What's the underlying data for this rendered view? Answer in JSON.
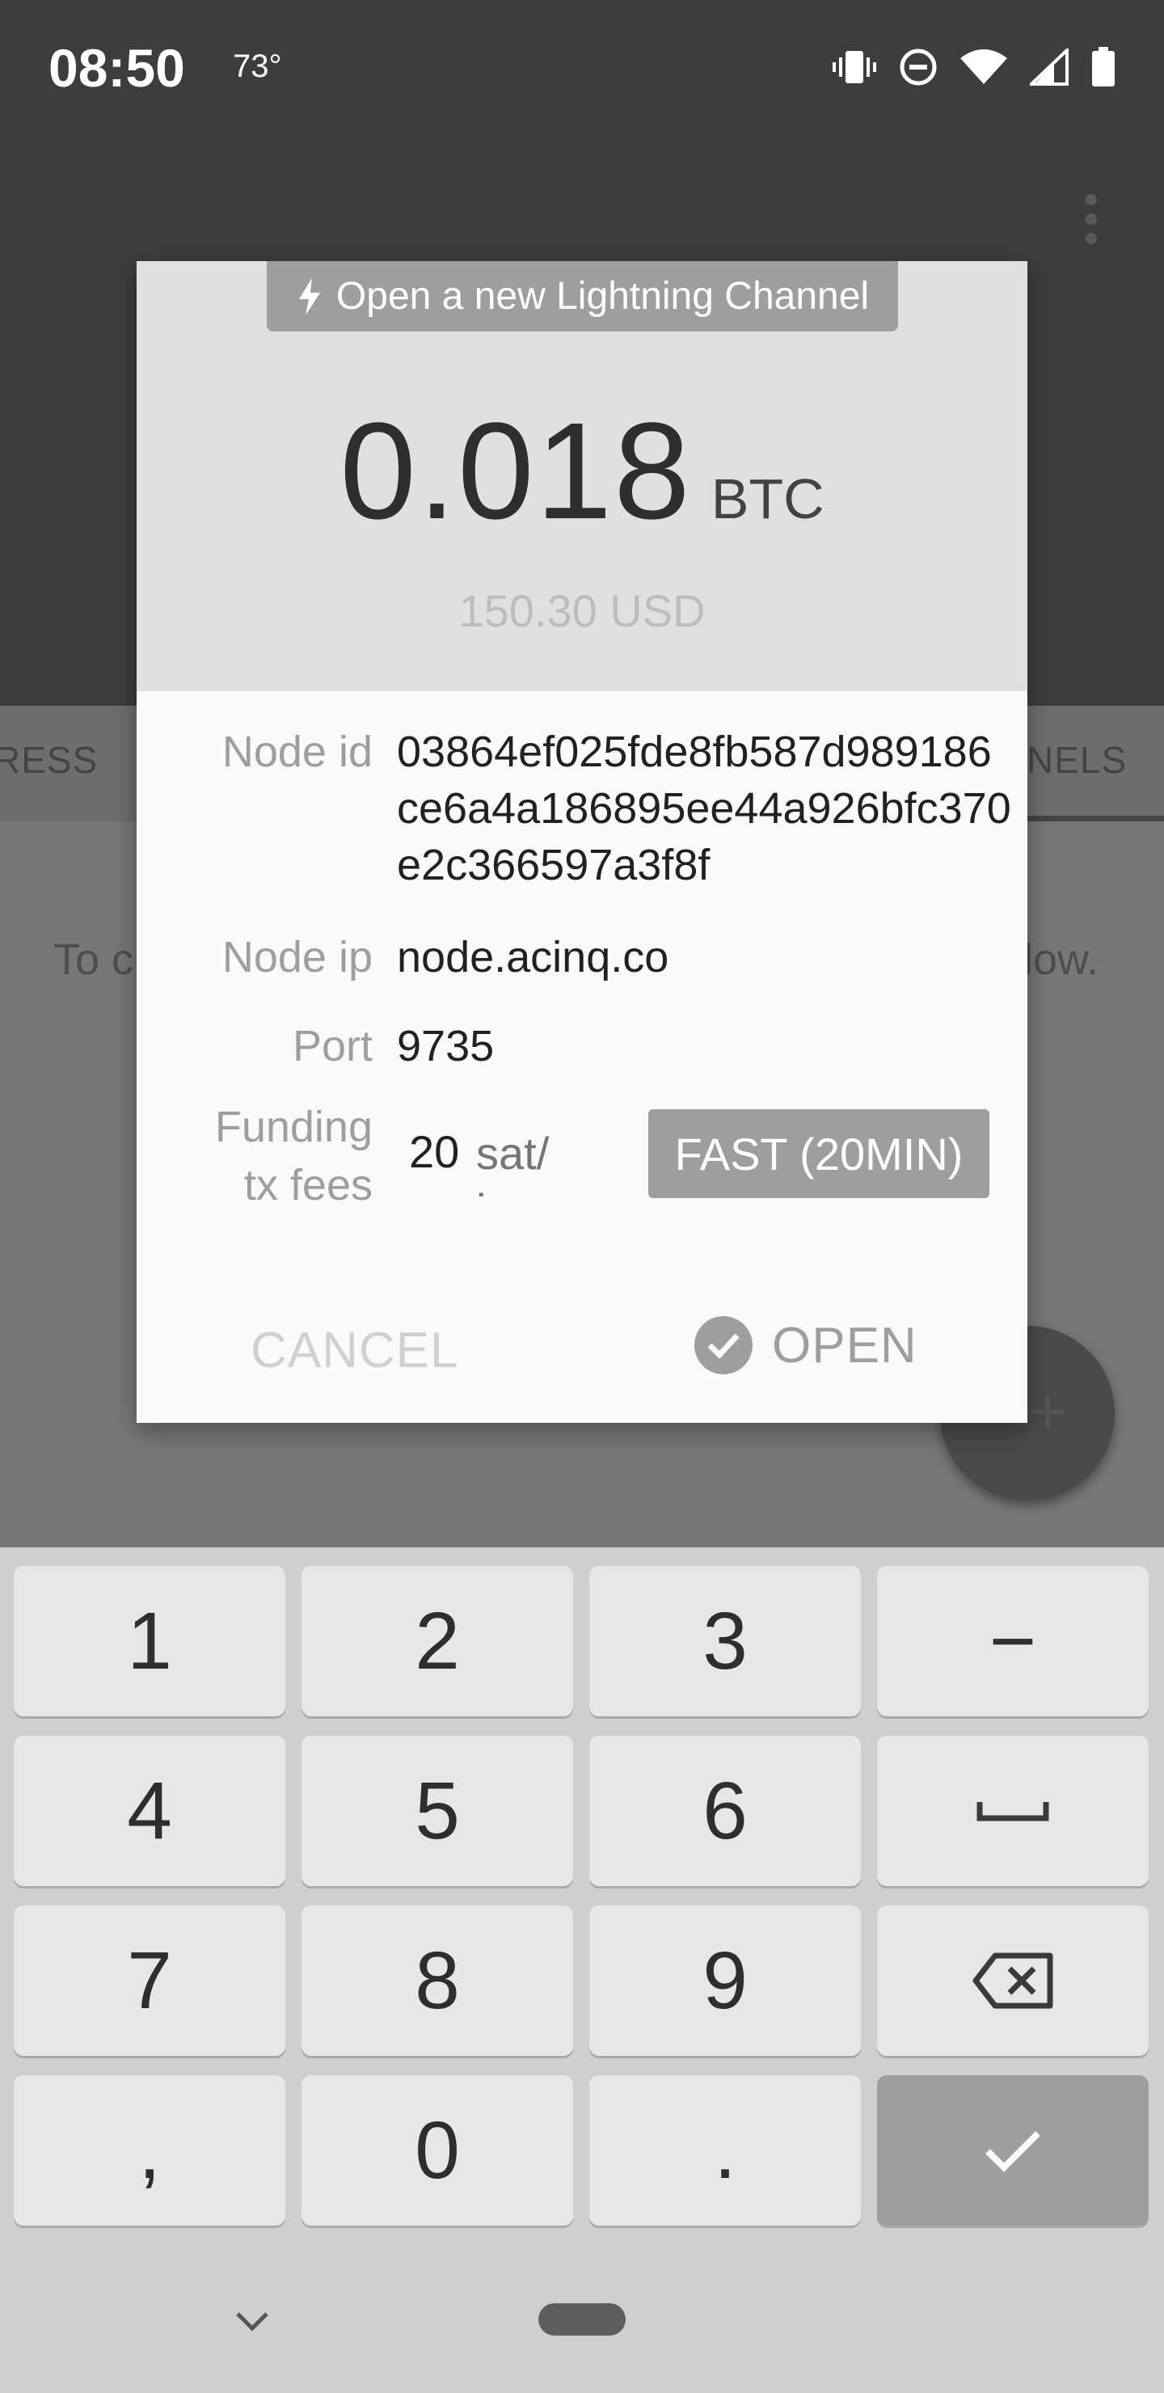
{
  "status_bar": {
    "time": "08:50",
    "temperature": "73°",
    "icons": [
      "vibrate-icon",
      "dnd-icon",
      "wifi-icon",
      "cell-signal-icon",
      "battery-icon"
    ]
  },
  "background": {
    "tab_left": "RESS",
    "tab_right": "NELS",
    "body_left": "To c",
    "body_right": "low."
  },
  "dialog": {
    "title": "Open a new Lightning Channel",
    "amount": "0.018",
    "unit": "BTC",
    "fiat": "150.30 USD",
    "node_id_label": "Node id",
    "node_id": "03864ef025fde8fb587d989186ce6a4a186895ee44a926bfc370e2c366597a3f8f",
    "node_ip_label": "Node ip",
    "node_ip": "node.acinq.co",
    "port_label": "Port",
    "port": "9735",
    "fees_label": "Funding tx fees",
    "fees_value": "20",
    "fees_unit": "sat/ byte",
    "fast_button": "FAST (20MIN)",
    "cancel": "CANCEL",
    "open": "OPEN"
  },
  "keyboard": {
    "keys": [
      "1",
      "2",
      "3",
      "−",
      "4",
      "5",
      "6",
      "␣",
      "7",
      "8",
      "9",
      "⌫",
      ",",
      "0",
      ".",
      "✓"
    ]
  }
}
